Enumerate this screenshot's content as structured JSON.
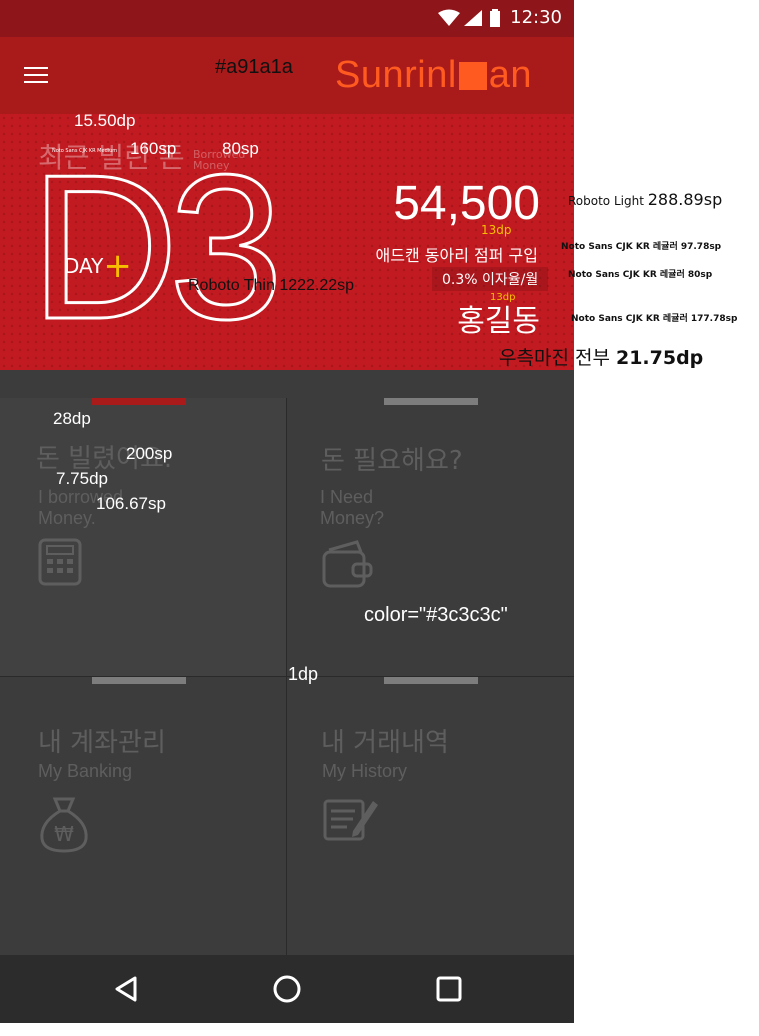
{
  "status": {
    "time": "12:30"
  },
  "logo": {
    "pre": "Sunrinl",
    "post": "an"
  },
  "hero": {
    "title": "최근 빌린 돈",
    "sub_line1": "Borrowed",
    "sub_line2": "Money",
    "big": "D3",
    "day_label": "DAY",
    "day_plus": "+",
    "amount": "54,500",
    "purpose": "애드캔 동아리 점퍼 구입",
    "rate": "0.3% 이자율/월",
    "person": "홍길동"
  },
  "tiles": [
    {
      "ko": "돈 빌렸어요.",
      "en1": "I borrowed",
      "en2": "Money.",
      "icon": "calculator-icon"
    },
    {
      "ko": "돈 필요해요?",
      "en1": "I Need",
      "en2": "Money?",
      "icon": "wallet-icon"
    },
    {
      "ko": "내 계좌관리",
      "en1": "My Banking",
      "en2": "",
      "icon": "money-bag-icon"
    },
    {
      "ko": "내 거래내역",
      "en1": "My History",
      "en2": "",
      "icon": "document-edit-icon"
    }
  ],
  "annotations": {
    "appbar_color": "#a91a1a",
    "dp_15_50": "15.50dp",
    "font_medium": "Noto Sans CJK KR Medium",
    "sp_160": "160sp",
    "sp_80": "80sp",
    "roboto_light": "Roboto Light",
    "sp_288": "288.89sp",
    "dp_13": "13dp",
    "noto_97": "Noto Sans CJK KR 레귤러 97.78sp",
    "noto_80": "Noto Sans CJK KR 레귤러 80sp",
    "dp_13b": "13dp",
    "noto_177": "Noto Sans CJK KR 레귤러 177.78sp",
    "roboto_thin": "Roboto Thin 1222.22sp",
    "right_margin_label": "우측마진 전부",
    "right_margin_value": "21.75dp",
    "dp_28": "28dp",
    "sp_200": "200sp",
    "dp_7_75": "7.75dp",
    "sp_106": "106.67sp",
    "tile_color": "color=\"#3c3c3c\"",
    "dp_1": "1dp"
  },
  "colors": {
    "appbar": "#a91a1a",
    "hero": "#c11a20",
    "tile": "#3c3c3c",
    "logo": "#ff5a1f",
    "accent": "#f6c000"
  }
}
